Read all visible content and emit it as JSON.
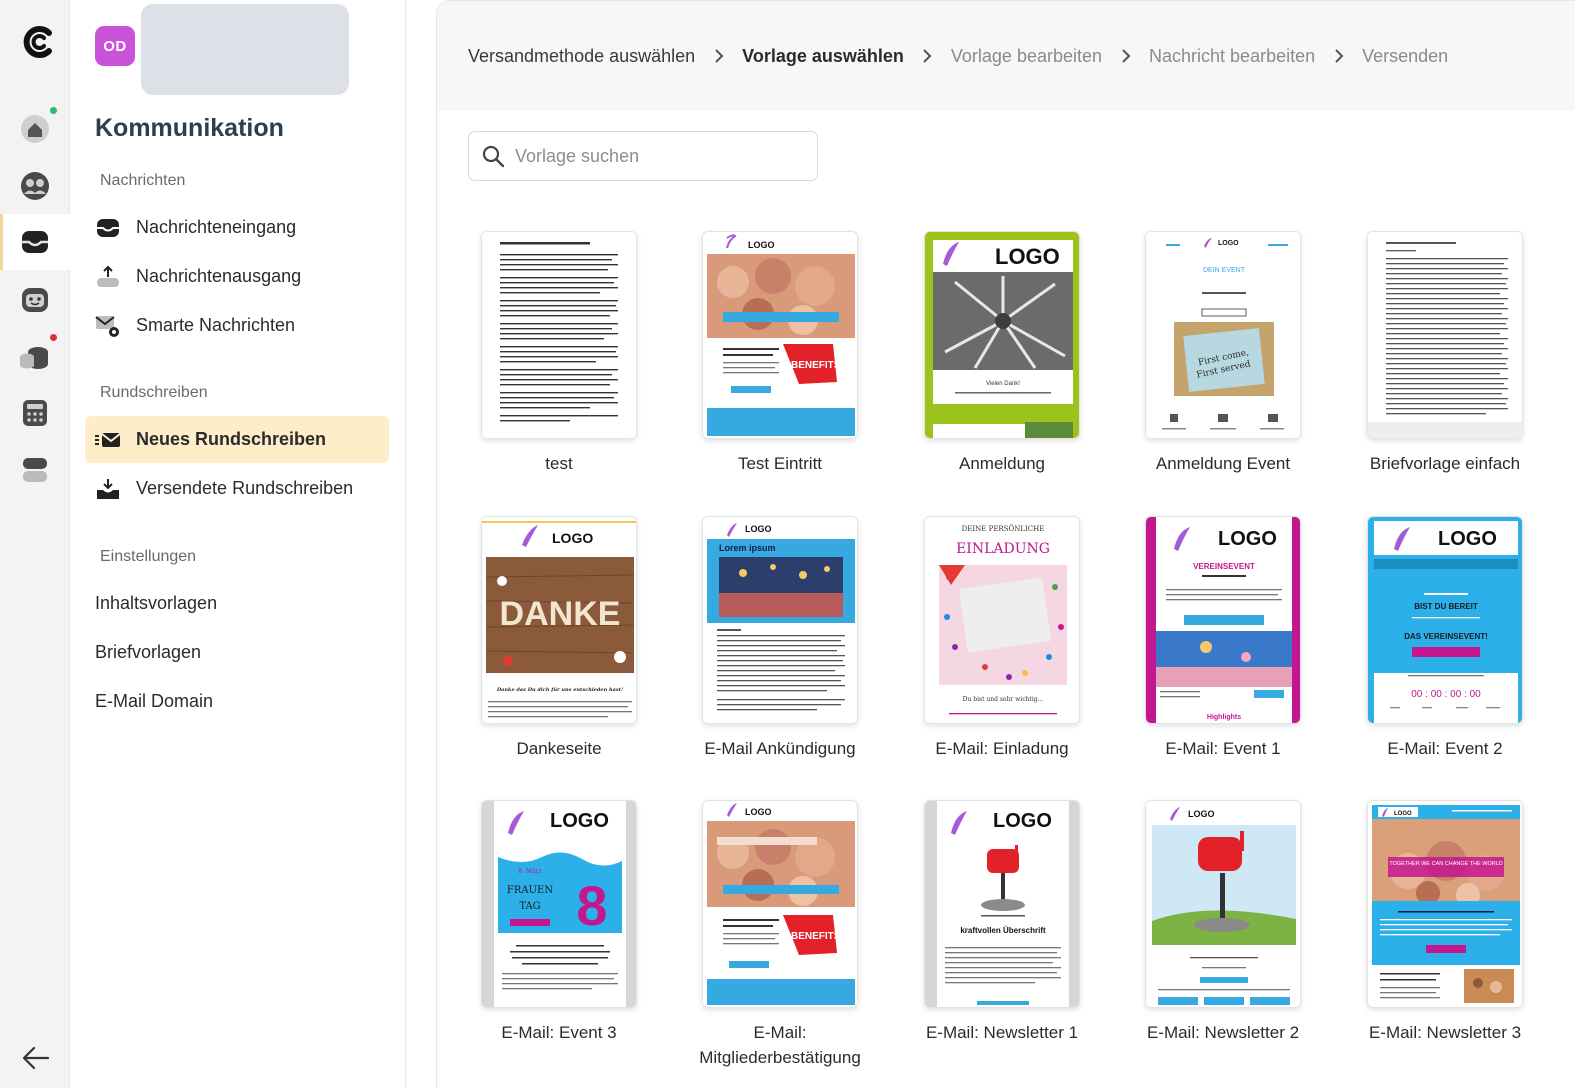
{
  "sidebar": {
    "avatar_initials": "OD",
    "title": "Kommunikation",
    "sections": {
      "nachrichten": "Nachrichten",
      "rundschreiben": "Rundschreiben",
      "einstellungen": "Einstellungen"
    },
    "items": {
      "eingang": "Nachrichteneingang",
      "ausgang": "Nachrichtenausgang",
      "smarte": "Smarte Nachrichten",
      "neues": "Neues Rundschreiben",
      "versendete": "Versendete Rundschreiben"
    },
    "links": {
      "inhaltsvorlagen": "Inhaltsvorlagen",
      "briefvorlagen": "Briefvorlagen",
      "email_domain": "E-Mail Domain"
    }
  },
  "breadcrumb": [
    "Versandmethode auswählen",
    "Vorlage auswählen",
    "Vorlage bearbeiten",
    "Nachricht bearbeiten",
    "Versenden"
  ],
  "search": {
    "placeholder": "Vorlage suchen"
  },
  "templates": [
    {
      "label": "test"
    },
    {
      "label": "Test Eintritt"
    },
    {
      "label": "Anmeldung"
    },
    {
      "label": "Anmeldung Event"
    },
    {
      "label": "Briefvorlage einfach"
    },
    {
      "label": "Dankeseite"
    },
    {
      "label": "E-Mail Ankündigung"
    },
    {
      "label": "E-Mail: Einladung"
    },
    {
      "label": "E-Mail: Event 1"
    },
    {
      "label": "E-Mail: Event 2"
    },
    {
      "label": "E-Mail: Event 3"
    },
    {
      "label": "E-Mail: Mitgliederbestätigung"
    },
    {
      "label": "E-Mail: Newsletter 1"
    },
    {
      "label": "E-Mail: Newsletter 2"
    },
    {
      "label": "E-Mail: Newsletter 3"
    }
  ],
  "thumb_text": {
    "logo": "LOGO",
    "benefits": "BENEFITS",
    "danke": "DANKE",
    "lorem": "Lorem ipsum",
    "einladung_top": "DEINE PERSÖNLICHE",
    "einladung": "EINLADUNG",
    "dein_event": "DEIN EVENT",
    "first_come": "First come,",
    "first_served": "First served",
    "vereinsevent": "VEREINSEVENT",
    "highlights": "Highlights",
    "bist_du_bereit": "BIST DU BEREIT",
    "das_vereinsevent": "DAS VEREINSEVENT!",
    "countdown": "00 : 00 : 00 : 00",
    "frauen": "FRAUEN",
    "tag": "TAG",
    "eight": "8",
    "maerz": "8. März",
    "kraftvoll": "kraftvollen Überschrift",
    "together": "TOGETHER WE CAN CHANGE THE WORLD",
    "vielen_dank": "Vielen Dank!",
    "danke_text": "Danke das Du dich für uns entschieden hast!",
    "du_bist": "Du bist und sehr wichtig..."
  },
  "colors": {
    "accent_sidebar": "#fdeec9",
    "avatar": "#c852d8",
    "email_blue": "#2bb0ea",
    "magenta": "#c4168f",
    "lime": "#9bc31c"
  }
}
